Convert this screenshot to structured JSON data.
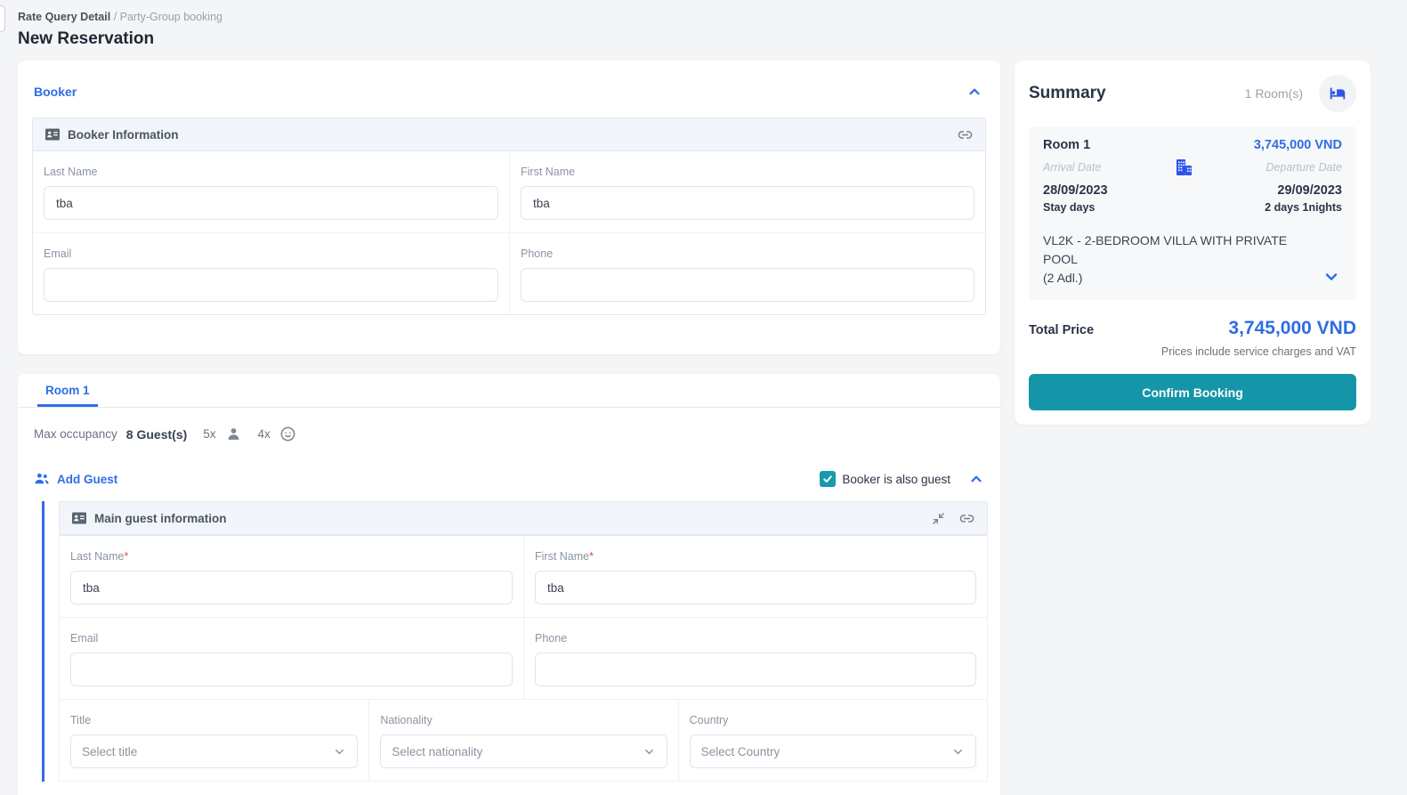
{
  "breadcrumb": {
    "primary": "Rate Query Detail",
    "separator": " / ",
    "secondary": "Party-Group booking"
  },
  "page_title": "New Reservation",
  "colors": {
    "accent_blue": "#2f6de4",
    "teal": "#1596a8",
    "page_bg": "#f4f5f7"
  },
  "icons": {
    "contact_card": "contact-card-icon",
    "link": "link-icon",
    "minimize": "minimize-arrows-icon",
    "people": "people-icon",
    "adult": "person-icon",
    "child": "child-face-icon",
    "bed": "bed-icon",
    "building": "building-icon",
    "chevron_up": "chevron-up-icon",
    "chevron_down": "chevron-down-icon",
    "check": "check-icon"
  },
  "booker": {
    "section_title": "Booker",
    "card_title": "Booker Information",
    "fields": {
      "last_name": {
        "label": "Last Name",
        "value": "tba"
      },
      "first_name": {
        "label": "First Name",
        "value": "tba"
      },
      "email": {
        "label": "Email",
        "value": ""
      },
      "phone": {
        "label": "Phone",
        "value": ""
      }
    }
  },
  "rooms": {
    "tab_label": "Room 1",
    "occupancy": {
      "label": "Max occupancy",
      "total": "8 Guest(s)",
      "adults_mult": "5x",
      "children_mult": "4x"
    }
  },
  "guest": {
    "add_guest_label": "Add Guest",
    "booker_is_guest_label": "Booker is also guest",
    "card_title": "Main guest information",
    "required_mark": "*",
    "fields": {
      "last_name": {
        "label": "Last Name",
        "value": "tba"
      },
      "first_name": {
        "label": "First Name",
        "value": "tba"
      },
      "email": {
        "label": "Email",
        "value": ""
      },
      "phone": {
        "label": "Phone",
        "value": ""
      },
      "title": {
        "label": "Title",
        "placeholder": "Select title"
      },
      "nationality": {
        "label": "Nationality",
        "placeholder": "Select nationality"
      },
      "country": {
        "label": "Country",
        "placeholder": "Select Country"
      }
    }
  },
  "summary": {
    "title": "Summary",
    "rooms_count": "1 Room(s)",
    "room": {
      "name": "Room 1",
      "price": "3,745,000 VND",
      "arrival_label": "Arrival Date",
      "departure_label": "Departure Date",
      "arrival_date": "28/09/2023",
      "departure_date": "29/09/2023",
      "stay_days_label": "Stay days",
      "stay_days_value": "2 days 1nights",
      "room_type_line1": "VL2K - 2-BEDROOM VILLA WITH PRIVATE POOL",
      "room_type_line2": "(2 Adl.)"
    },
    "total_price_label": "Total Price",
    "total_price": "3,745,000 VND",
    "price_note": "Prices include service charges and VAT",
    "confirm_label": "Confirm Booking"
  }
}
